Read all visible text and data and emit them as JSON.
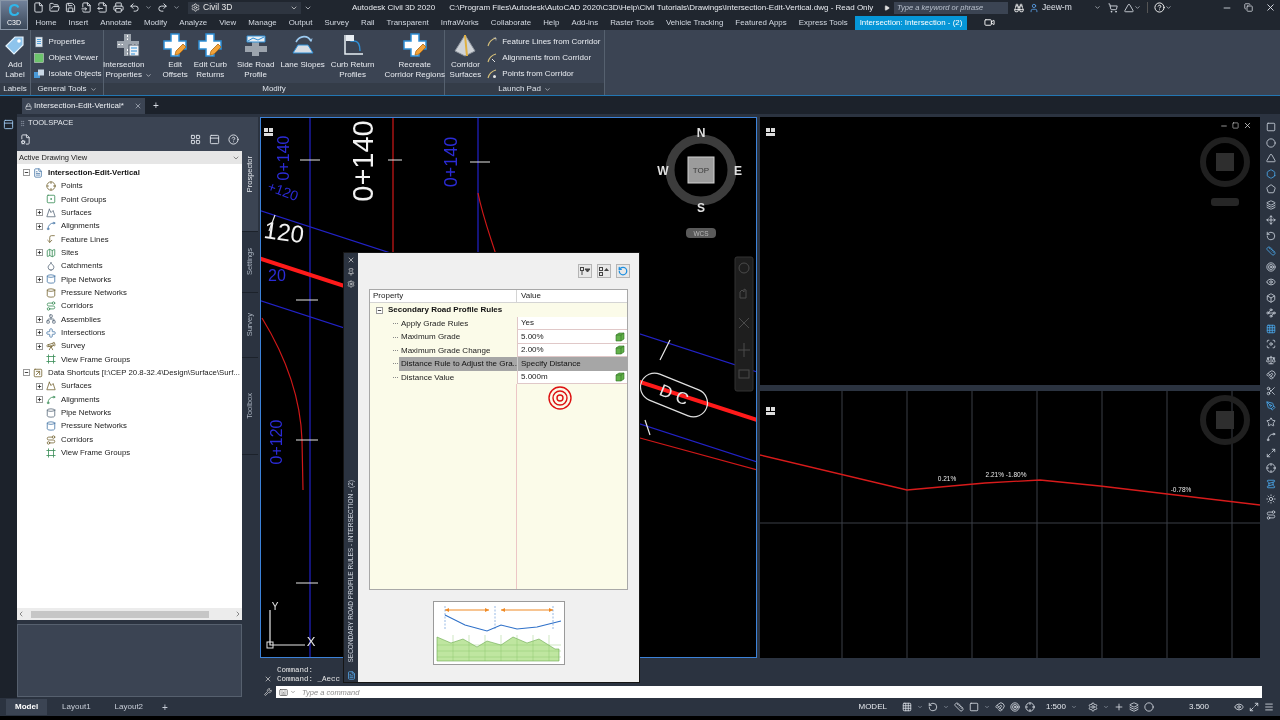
{
  "title_bar": {
    "app_letter": "C",
    "app_caption": "C3D",
    "workspace": "Civil 3D",
    "title": "Autodesk Civil 3D 2020",
    "path": "C:\\Program Files\\Autodesk\\AutoCAD 2020\\C3D\\Help\\Civil Tutorials\\Drawings\\Intersection-Edit-Vertical.dwg - Read Only",
    "search": {
      "placeholder": "Type a keyword or phrase"
    },
    "user": "Jeew-m"
  },
  "ribbon_tabs": [
    {
      "label": "Home",
      "selected": false
    },
    {
      "label": "Insert",
      "selected": false
    },
    {
      "label": "Annotate",
      "selected": false
    },
    {
      "label": "Modify",
      "selected": false
    },
    {
      "label": "Analyze",
      "selected": false
    },
    {
      "label": "View",
      "selected": false
    },
    {
      "label": "Manage",
      "selected": false
    },
    {
      "label": "Output",
      "selected": false
    },
    {
      "label": "Survey",
      "selected": false
    },
    {
      "label": "Rail",
      "selected": false
    },
    {
      "label": "Transparent",
      "selected": false
    },
    {
      "label": "InfraWorks",
      "selected": false
    },
    {
      "label": "Collaborate",
      "selected": false
    },
    {
      "label": "Help",
      "selected": false
    },
    {
      "label": "Add-ins",
      "selected": false
    },
    {
      "label": "Raster Tools",
      "selected": false
    },
    {
      "label": "Vehicle Tracking",
      "selected": false
    },
    {
      "label": "Featured Apps",
      "selected": false
    },
    {
      "label": "Express Tools",
      "selected": false
    },
    {
      "label": "Intersection: Intersection - (2)",
      "selected": true
    }
  ],
  "ribbon_panels": [
    {
      "title": "Labels",
      "menu": false,
      "groups": [
        [
          {
            "kind": "large",
            "label": "Add\nLabel",
            "dropdown": false
          }
        ]
      ]
    },
    {
      "title": "General Tools",
      "menu": true,
      "groups": [
        [
          {
            "kind": "small",
            "label": "Properties"
          },
          {
            "kind": "small",
            "label": "Object Viewer"
          },
          {
            "kind": "small",
            "label": "Isolate Objects"
          }
        ]
      ]
    },
    {
      "title": "Modify",
      "menu": false,
      "groups": [
        [
          {
            "kind": "large",
            "label": "Intersection\nProperties",
            "dropdown": true
          }
        ],
        [
          {
            "kind": "large",
            "label": "Edit\nOffsets",
            "dropdown": false
          },
          {
            "kind": "large",
            "label": "Edit Curb\nReturns",
            "dropdown": false
          }
        ],
        [
          {
            "kind": "large",
            "label": "Side Road\nProfile",
            "dropdown": false
          },
          {
            "kind": "large",
            "label": "Lane Slopes",
            "dropdown": false
          },
          {
            "kind": "large",
            "label": "Curb Return\nProfiles",
            "dropdown": false
          }
        ],
        [
          {
            "kind": "large",
            "label": "Recreate\nCorridor Regions",
            "dropdown": false
          }
        ]
      ]
    },
    {
      "title": "Launch Pad",
      "menu": true,
      "groups": [
        [
          {
            "kind": "large",
            "label": "Corridor\nSurfaces",
            "dropdown": false
          }
        ],
        [
          {
            "kind": "small",
            "label": "Feature Lines from Corridor"
          },
          {
            "kind": "small",
            "label": "Alignments from Corridor"
          },
          {
            "kind": "small",
            "label": "Points from Corridor"
          }
        ]
      ]
    }
  ],
  "file_tabs": {
    "tabs": [
      {
        "label": "Intersection-Edit-Vertical*",
        "selected": true,
        "locked": true
      }
    ],
    "new_tab": "+"
  },
  "toolspace": {
    "title": "TOOLSPACE",
    "view": "Active Drawing View",
    "tree": [
      {
        "label": "Intersection-Edit-Vertical",
        "expanded": true,
        "children": [
          {
            "label": "Points"
          },
          {
            "label": "Point Groups"
          },
          {
            "label": "Surfaces",
            "expanded": false
          },
          {
            "label": "Alignments",
            "expanded": false
          },
          {
            "label": "Feature Lines"
          },
          {
            "label": "Sites",
            "expanded": false
          },
          {
            "label": "Catchments"
          },
          {
            "label": "Pipe Networks",
            "expanded": false
          },
          {
            "label": "Pressure Networks"
          },
          {
            "label": "Corridors"
          },
          {
            "label": "Assemblies",
            "expanded": false
          },
          {
            "label": "Intersections",
            "expanded": false
          },
          {
            "label": "Survey",
            "expanded": false
          },
          {
            "label": "View Frame Groups"
          }
        ]
      },
      {
        "label": "Data Shortcuts [I:\\CEP 20.8-32.4\\Design\\Surface\\Surf...",
        "expanded": true,
        "children": [
          {
            "label": "Surfaces",
            "expanded": false
          },
          {
            "label": "Alignments",
            "expanded": false
          },
          {
            "label": "Pipe Networks"
          },
          {
            "label": "Pressure Networks"
          },
          {
            "label": "Corridors"
          },
          {
            "label": "View Frame Groups"
          }
        ]
      }
    ],
    "side_tabs": [
      {
        "label": "Prospector",
        "selected": true
      },
      {
        "label": "Settings",
        "selected": false
      },
      {
        "label": "Survey",
        "selected": false
      },
      {
        "label": "Toolbox",
        "selected": false
      }
    ]
  },
  "plan_view": {
    "labels": [
      "0+140",
      "120",
      "0+140",
      "0+140",
      "+120",
      "20",
      "0+120"
    ],
    "road_label": "D C",
    "view_cube": {
      "top": "TOP",
      "north": "N",
      "south": "S",
      "west": "W",
      "east": "E",
      "ucs_menu": "WCS"
    },
    "ucs_axes": {
      "y": "Y",
      "x": "X"
    }
  },
  "profile_view": {
    "grade_labels": [
      "0.21%",
      "2.21% -1.80%",
      "-0.78%"
    ]
  },
  "property_panel": {
    "side_title": "SECONDARY ROAD PROFILE RULES - INTERSECTION - (2)",
    "columns": [
      "Property",
      "Value"
    ],
    "category": {
      "label": "Secondary Road Profile Rules",
      "expanded": true
    },
    "rows": [
      {
        "property": "Apply Grade Rules",
        "value": "Yes",
        "picker": false,
        "selected": false
      },
      {
        "property": "Maximum Grade",
        "value": "5.00%",
        "picker": true,
        "selected": false
      },
      {
        "property": "Maximum Grade Change",
        "value": "2.00%",
        "picker": true,
        "selected": false
      },
      {
        "property": "Distance Rule to Adjust the Gra...",
        "value": "Specify Distance",
        "picker": false,
        "selected": true
      },
      {
        "property": "Distance Value",
        "value": "5.000m",
        "picker": true,
        "selected": false
      }
    ]
  },
  "command_line": {
    "history": [
      "Command:",
      "Command: _Aecc"
    ],
    "input": {
      "placeholder": "Type a command"
    }
  },
  "layout_tabs": {
    "tabs": [
      {
        "label": "Model",
        "selected": true
      },
      {
        "label": "Layout1",
        "selected": false
      },
      {
        "label": "Layout2",
        "selected": false
      }
    ],
    "new_tab": "+"
  },
  "status_bar": {
    "space": "MODEL",
    "scale": "1:500",
    "readout": "3.500"
  }
}
